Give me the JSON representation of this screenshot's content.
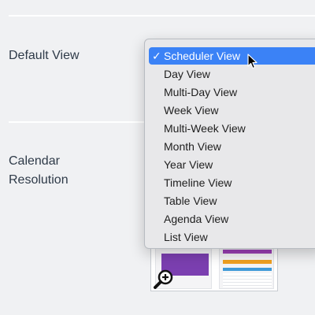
{
  "settings": {
    "default_view_label": "Default View",
    "calendar_resolution_label": "Calendar\nResolution"
  },
  "dropdown": {
    "selected_index": 0,
    "check_glyph": "✓",
    "options": [
      "Scheduler View",
      "Day View",
      "Multi-Day View",
      "Week View",
      "Multi-Week View",
      "Month View",
      "Year View",
      "Timeline View",
      "Table View",
      "Agenda View",
      "List View"
    ]
  },
  "colors": {
    "selected_highlight": "#3b82f6",
    "preview_purple": "#7b3fb0",
    "preview_orange": "#f0a020",
    "preview_blue": "#3f9ad8"
  },
  "icons": {
    "preview_zoom": "zoom-in-icon",
    "pointer": "mouse-cursor-icon"
  }
}
